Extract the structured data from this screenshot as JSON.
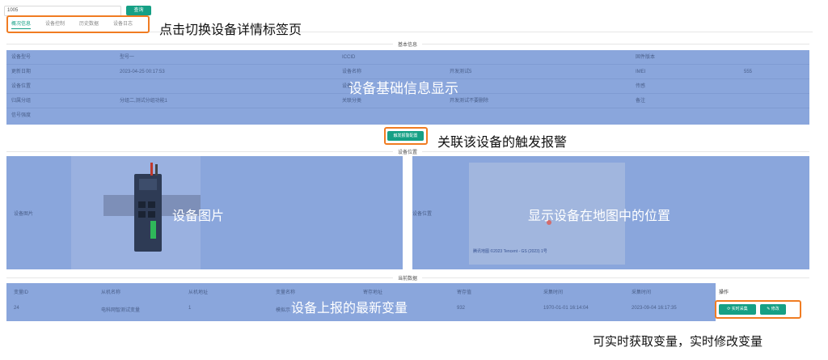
{
  "search": {
    "value": "1005",
    "button": "查询"
  },
  "tabs": [
    {
      "label": "概况信息",
      "active": true
    },
    {
      "label": "设备控制",
      "active": false
    },
    {
      "label": "历史数据",
      "active": false
    },
    {
      "label": "设备日志",
      "active": false
    }
  ],
  "callouts": {
    "tabs": "点击切换设备详情标签页",
    "basic_info": "设备基础信息显示",
    "alarm": "关联该设备的触发报警",
    "image": "设备图片",
    "map": "显示设备在地图中的位置",
    "variables": "设备上报的最新变量",
    "ops": "可实时获取变量，实时修改变量"
  },
  "sections": {
    "basic_info": "基本信息",
    "position": "设备位置",
    "current_data": "当前数据"
  },
  "basic_info": {
    "rows": [
      [
        {
          "label": "设备型号",
          "value": "型号一"
        },
        {
          "label": "ICCID",
          "value": ""
        },
        {
          "label": "固件版本",
          "value": ""
        }
      ],
      [
        {
          "label": "更新日期",
          "value": "2023-04-25 00:17:53"
        },
        {
          "label": "设备名称",
          "value": "开发测试5"
        },
        {
          "label": "IMEI",
          "value": "555"
        }
      ],
      [
        {
          "label": "设备位置",
          "value": ""
        },
        {
          "label": "设备",
          "value": ""
        },
        {
          "label": "传感",
          "value": ""
        }
      ],
      [
        {
          "label": "归属分组",
          "value": "分组二,测试分组功能1"
        },
        {
          "label": "关联分类",
          "value": "开发测试不要删除"
        },
        {
          "label": "备注",
          "value": ""
        }
      ],
      [
        {
          "label": "信号强度",
          "value": ""
        }
      ]
    ]
  },
  "alarm_button": "触发报警配置",
  "image_panel": {
    "label": "设备图片"
  },
  "map_panel": {
    "label": "设备位置",
    "attribution": "腾讯地图 ©2023 Tencent - GS (2023) 1号"
  },
  "variables": {
    "columns": [
      "变量ID",
      "从机名称",
      "从机地址",
      "变量名称",
      "寄存地址",
      "寄存值",
      "采集时间",
      "采集时间",
      "操作"
    ],
    "row": [
      "24",
      "电科网智测试变量",
      "1",
      "模拟示",
      "",
      "932",
      "1970-01-01 16:14:04",
      "2023-09-04 16:17:35"
    ],
    "actions": {
      "realtime": "实时采集",
      "edit": "修改"
    }
  },
  "colors": {
    "accent": "#16a085",
    "highlight": "#f07c22",
    "overlay": "#8aa6dc"
  }
}
